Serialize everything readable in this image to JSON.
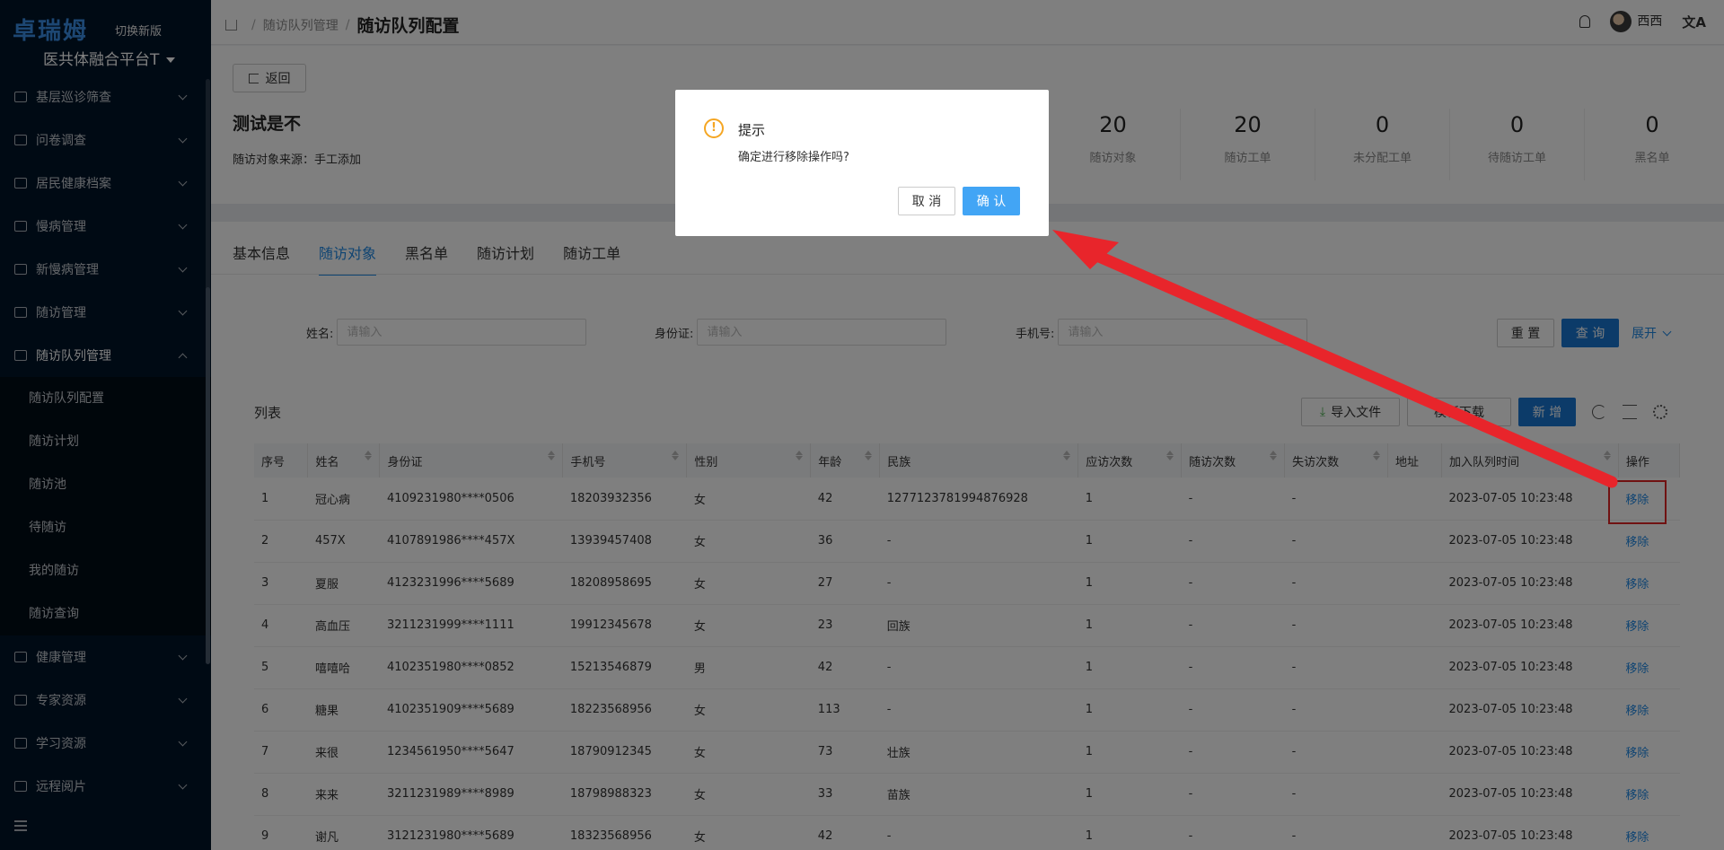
{
  "sidebar": {
    "logo": "卓瑞姆",
    "switch_label": "切换新版",
    "platform": "医共体融合平台T",
    "menu_top": [
      {
        "label": "基层巡诊筛查"
      },
      {
        "label": "问卷调查"
      },
      {
        "label": "居民健康档案"
      },
      {
        "label": "慢病管理"
      },
      {
        "label": "新慢病管理"
      },
      {
        "label": "随访管理"
      }
    ],
    "open_menu": {
      "label": "随访队列管理"
    },
    "submenu": [
      "随访队列配置",
      "随访计划",
      "随访池",
      "待随访",
      "我的随访",
      "随访查询"
    ],
    "menu_bottom": [
      {
        "label": "健康管理"
      },
      {
        "label": "专家资源"
      },
      {
        "label": "学习资源"
      },
      {
        "label": "远程阅片"
      }
    ]
  },
  "header": {
    "breadcrumb_parent": "随访队列管理",
    "breadcrumb_current": "随访队列配置",
    "user": "西西",
    "lang_icon": "文A"
  },
  "detail": {
    "back_label": "返回",
    "title": "测试是不",
    "source": "随访对象来源：手工添加",
    "stats": [
      {
        "num": "20",
        "label": "随访对象"
      },
      {
        "num": "20",
        "label": "随访工单"
      },
      {
        "num": "0",
        "label": "未分配工单"
      },
      {
        "num": "0",
        "label": "待随访工单"
      },
      {
        "num": "0",
        "label": "黑名单"
      }
    ]
  },
  "tabs": [
    "基本信息",
    "随访对象",
    "黑名单",
    "随访计划",
    "随访工单"
  ],
  "filters": {
    "name_label": "姓名:",
    "name_placeholder": "请输入",
    "id_label": "身份证:",
    "id_placeholder": "请输入",
    "phone_label": "手机号:",
    "phone_placeholder": "请输入",
    "reset": "重 置",
    "query": "查 询",
    "expand": "展开"
  },
  "list": {
    "title": "列表",
    "import": "导入文件",
    "template": "模板下载",
    "add": "新 增",
    "columns": [
      "序号",
      "姓名",
      "身份证",
      "手机号",
      "性别",
      "年龄",
      "民族",
      "应访次数",
      "随访次数",
      "失访次数",
      "地址",
      "加入队列时间",
      "操作"
    ],
    "rows": [
      {
        "no": "1",
        "name": "冠心病",
        "id": "4109231980****0506",
        "phone": "18203932356",
        "sex": "女",
        "age": "42",
        "nation": "1277123781994876928",
        "due": "1",
        "done": "-",
        "lost": "-",
        "addr": "",
        "time": "2023-07-05 10:23:48",
        "op": "移除"
      },
      {
        "no": "2",
        "name": "457X",
        "id": "4107891986****457X",
        "phone": "13939457408",
        "sex": "女",
        "age": "36",
        "nation": "-",
        "due": "1",
        "done": "-",
        "lost": "-",
        "addr": "",
        "time": "2023-07-05 10:23:48",
        "op": "移除"
      },
      {
        "no": "3",
        "name": "夏服",
        "id": "4123231996****5689",
        "phone": "18208958695",
        "sex": "女",
        "age": "27",
        "nation": "-",
        "due": "1",
        "done": "-",
        "lost": "-",
        "addr": "",
        "time": "2023-07-05 10:23:48",
        "op": "移除"
      },
      {
        "no": "4",
        "name": "高血压",
        "id": "3211231999****1111",
        "phone": "19912345678",
        "sex": "女",
        "age": "23",
        "nation": "回族",
        "due": "1",
        "done": "-",
        "lost": "-",
        "addr": "",
        "time": "2023-07-05 10:23:48",
        "op": "移除"
      },
      {
        "no": "5",
        "name": "嘻嘻哈",
        "id": "4102351980****0852",
        "phone": "15213546879",
        "sex": "男",
        "age": "42",
        "nation": "-",
        "due": "1",
        "done": "-",
        "lost": "-",
        "addr": "",
        "time": "2023-07-05 10:23:48",
        "op": "移除"
      },
      {
        "no": "6",
        "name": "糖果",
        "id": "4102351909****5689",
        "phone": "18223568956",
        "sex": "女",
        "age": "113",
        "nation": "-",
        "due": "1",
        "done": "-",
        "lost": "-",
        "addr": "",
        "time": "2023-07-05 10:23:48",
        "op": "移除"
      },
      {
        "no": "7",
        "name": "来很",
        "id": "1234561950****5647",
        "phone": "18790912345",
        "sex": "女",
        "age": "73",
        "nation": "壮族",
        "due": "1",
        "done": "-",
        "lost": "-",
        "addr": "",
        "time": "2023-07-05 10:23:48",
        "op": "移除"
      },
      {
        "no": "8",
        "name": "来来",
        "id": "3211231989****8989",
        "phone": "18798988323",
        "sex": "女",
        "age": "33",
        "nation": "苗族",
        "due": "1",
        "done": "-",
        "lost": "-",
        "addr": "",
        "time": "2023-07-05 10:23:48",
        "op": "移除"
      },
      {
        "no": "9",
        "name": "谢凡",
        "id": "3121231980****5689",
        "phone": "18323568956",
        "sex": "女",
        "age": "42",
        "nation": "-",
        "due": "1",
        "done": "-",
        "lost": "-",
        "addr": "",
        "time": "2023-07-05 10:23:48",
        "op": "移除"
      }
    ]
  },
  "dialog": {
    "title": "提示",
    "message": "确定进行移除操作吗?",
    "cancel": "取 消",
    "ok": "确 认",
    "icon": "!"
  },
  "colors": {
    "sidebar_bg": "#001529",
    "primary": "#1976d2",
    "link": "#1e88e5",
    "annotation_red": "#e02424"
  }
}
